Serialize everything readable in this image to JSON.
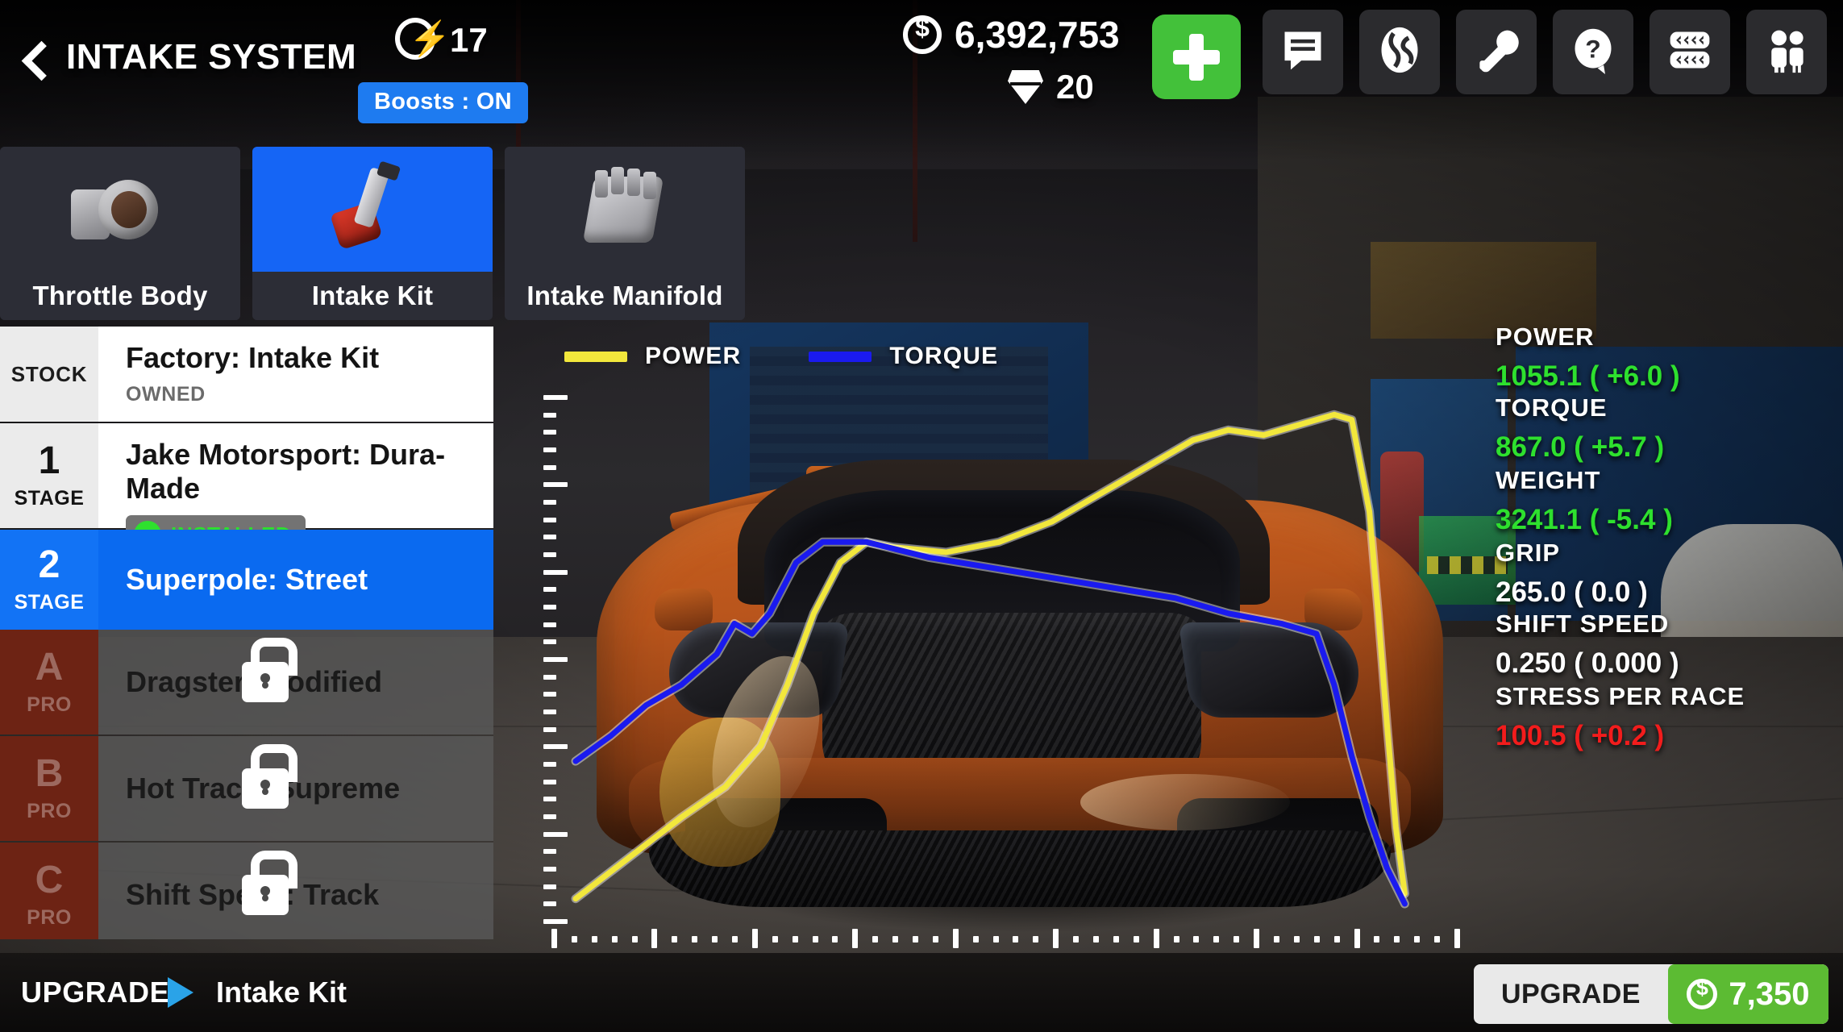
{
  "header": {
    "back_icon": "chevron-left-icon",
    "title": "INTAKE SYSTEM",
    "boost": {
      "icon": "boost-bolt-icon",
      "count": "17",
      "toggle_label": "Boosts : ON"
    },
    "currency": {
      "cash_icon": "coin-dollar-icon",
      "cash": "6,392,753",
      "gem_icon": "gem-icon",
      "gems": "20"
    },
    "add_button": {
      "icon": "plus-icon"
    },
    "icon_buttons": [
      {
        "name": "chat-icon",
        "label": "Chat"
      },
      {
        "name": "globe-icon",
        "label": "World"
      },
      {
        "name": "wrench-icon",
        "label": "Tune"
      },
      {
        "name": "question-icon",
        "label": "Help"
      },
      {
        "name": "tires-icon",
        "label": "Tires"
      },
      {
        "name": "multiplayer-icon",
        "label": "Crew"
      }
    ]
  },
  "tabs": [
    {
      "label": "Throttle Body",
      "icon": "throttle-body-icon",
      "active": false
    },
    {
      "label": "Intake Kit",
      "icon": "intake-kit-icon",
      "active": true
    },
    {
      "label": "Intake Manifold",
      "icon": "intake-manifold-icon",
      "active": false
    }
  ],
  "upgrade_list": [
    {
      "badge_num": "",
      "badge_sub": "STOCK",
      "title": "Factory: Intake Kit",
      "status": "OWNED",
      "state": "stock"
    },
    {
      "badge_num": "1",
      "badge_sub": "STAGE",
      "title": "Jake Motorsport: Dura-Made",
      "status": "INSTALLED",
      "state": "installed"
    },
    {
      "badge_num": "2",
      "badge_sub": "STAGE",
      "title": "Superpole: Street",
      "status": "",
      "state": "selected"
    },
    {
      "badge_num": "A",
      "badge_sub": "PRO",
      "title": "Dragster: Modified",
      "status": "",
      "state": "locked"
    },
    {
      "badge_num": "B",
      "badge_sub": "PRO",
      "title": "Hot Track: Supreme",
      "status": "",
      "state": "locked"
    },
    {
      "badge_num": "C",
      "badge_sub": "PRO",
      "title": "Shift Speed: Track",
      "status": "",
      "state": "locked"
    }
  ],
  "chart_data": {
    "type": "line",
    "title": "",
    "xlabel": "",
    "ylabel": "",
    "grid": false,
    "legend_position": "top-left",
    "x_ticks_major": 9,
    "x_ticks_minor_per_major": 5,
    "y_ticks_major": 6,
    "y_ticks_minor_per_major": 5,
    "series": [
      {
        "name": "POWER",
        "color": "#f2e73c",
        "points": [
          [
            0.0,
            0.04
          ],
          [
            0.06,
            0.12
          ],
          [
            0.12,
            0.2
          ],
          [
            0.17,
            0.26
          ],
          [
            0.21,
            0.34
          ],
          [
            0.24,
            0.46
          ],
          [
            0.27,
            0.6
          ],
          [
            0.3,
            0.7
          ],
          [
            0.33,
            0.74
          ],
          [
            0.36,
            0.73
          ],
          [
            0.42,
            0.72
          ],
          [
            0.48,
            0.74
          ],
          [
            0.54,
            0.78
          ],
          [
            0.6,
            0.84
          ],
          [
            0.66,
            0.9
          ],
          [
            0.7,
            0.94
          ],
          [
            0.74,
            0.96
          ],
          [
            0.78,
            0.95
          ],
          [
            0.82,
            0.97
          ],
          [
            0.86,
            0.99
          ],
          [
            0.88,
            0.98
          ],
          [
            0.9,
            0.8
          ],
          [
            0.91,
            0.6
          ],
          [
            0.92,
            0.38
          ],
          [
            0.93,
            0.18
          ],
          [
            0.94,
            0.05
          ]
        ]
      },
      {
        "name": "TORQUE",
        "color": "#1a1aef",
        "points": [
          [
            0.0,
            0.31
          ],
          [
            0.04,
            0.36
          ],
          [
            0.08,
            0.42
          ],
          [
            0.12,
            0.46
          ],
          [
            0.16,
            0.52
          ],
          [
            0.18,
            0.58
          ],
          [
            0.2,
            0.56
          ],
          [
            0.22,
            0.6
          ],
          [
            0.25,
            0.7
          ],
          [
            0.28,
            0.74
          ],
          [
            0.33,
            0.74
          ],
          [
            0.4,
            0.71
          ],
          [
            0.47,
            0.69
          ],
          [
            0.54,
            0.67
          ],
          [
            0.61,
            0.65
          ],
          [
            0.68,
            0.63
          ],
          [
            0.74,
            0.6
          ],
          [
            0.8,
            0.58
          ],
          [
            0.84,
            0.56
          ],
          [
            0.86,
            0.46
          ],
          [
            0.88,
            0.32
          ],
          [
            0.9,
            0.2
          ],
          [
            0.92,
            0.1
          ],
          [
            0.94,
            0.03
          ]
        ]
      }
    ]
  },
  "stats": [
    {
      "label": "POWER",
      "value": "1055.1 ( +6.0 )",
      "tone": "green"
    },
    {
      "label": "TORQUE",
      "value": "867.0 ( +5.7 )",
      "tone": "green"
    },
    {
      "label": "WEIGHT",
      "value": "3241.1 ( -5.4 )",
      "tone": "green"
    },
    {
      "label": "GRIP",
      "value": "265.0 ( 0.0 )",
      "tone": "white"
    },
    {
      "label": "SHIFT SPEED",
      "value": "0.250 ( 0.000 )",
      "tone": "white"
    },
    {
      "label": "STRESS PER RACE",
      "value": "100.5 ( +0.2 )",
      "tone": "red"
    }
  ],
  "bottom": {
    "upgrade_label": "UPGRADE",
    "arrow_icon": "play-arrow-icon",
    "part_name": "Intake Kit",
    "button_label": "UPGRADE",
    "price_icon": "coin-dollar-icon",
    "price": "7,350"
  },
  "colors": {
    "accent_blue": "#1565f5",
    "green": "#2ee02e",
    "red": "#f21c1c",
    "power_yellow": "#f2e73c",
    "torque_blue": "#1a1aef",
    "pro_red": "#6d2314",
    "buy_green": "#5cbb33"
  }
}
